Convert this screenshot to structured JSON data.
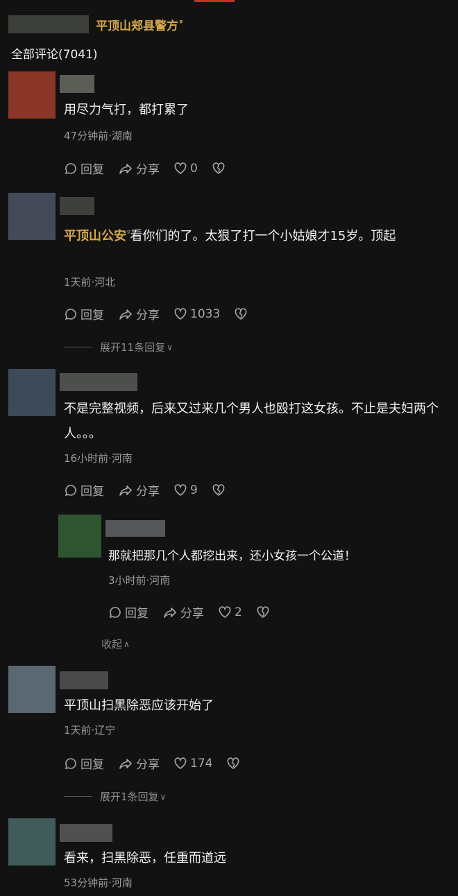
{
  "header": {
    "account_name": "平顶山郏县警方",
    "verified_mark": "ᵍ"
  },
  "comments_section": {
    "title": "全部评论(7041)"
  },
  "actions": {
    "reply": "回复",
    "share": "分享"
  },
  "comments": [
    {
      "text": "用尽力气打，都打累了",
      "meta": "47分钟前·湖南",
      "likes": "0",
      "colors": {
        "avatar": "#8a3628",
        "name": "#5a5e56"
      }
    },
    {
      "mention": "平顶山公安",
      "text": "看你们的了。太狠了打一个小姑娘才15岁。顶起",
      "meta": "1天前·河北",
      "likes": "1033",
      "expand": "展开11条回复",
      "colors": {
        "avatar": "#444a57",
        "name": "#3e403c"
      }
    },
    {
      "text": "不是完整视频，后来又过来几个男人也殴打这女孩。不止是夫妇两个人。。。",
      "meta": "16小时前·河南",
      "likes": "9",
      "colors": {
        "avatar": "#3d4a58",
        "name": "#4c4f4c"
      }
    },
    {
      "text": "那就把那几个人都挖出来，还小女孩一个公道！",
      "meta": "3小时前·河南",
      "likes": "2",
      "collapse": "收起",
      "colors": {
        "avatar": "#2e5530",
        "name": "#55575a"
      }
    },
    {
      "text": "平顶山扫黑除恶应该开始了",
      "meta": "1天前·辽宁",
      "likes": "174",
      "expand": "展开1条回复",
      "colors": {
        "avatar": "#5a6872",
        "name": "#4a4a4a"
      }
    },
    {
      "text": "看来，扫黑除恶，任重而道远",
      "meta": "53分钟前·河南",
      "colors": {
        "avatar": "#3f5c5a",
        "name": "#505050"
      }
    }
  ]
}
